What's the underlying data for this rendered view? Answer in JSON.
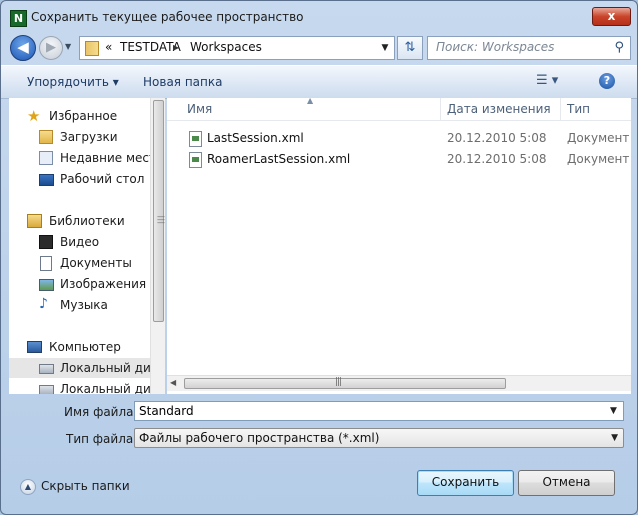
{
  "window": {
    "title": "Сохранить текущее рабочее пространство",
    "app_icon": "N",
    "close_glyph": "x"
  },
  "navigation": {
    "back_icon": "back-arrow-icon",
    "forward_icon": "forward-arrow-icon",
    "address": {
      "overflow_chevron": "«",
      "segments": [
        "TESTDATA",
        "Workspaces"
      ],
      "separator": "▸"
    },
    "search_placeholder": "Поиск: Workspaces"
  },
  "toolbar": {
    "organize_label": "Упорядочить ▾",
    "new_folder_label": "Новая папка"
  },
  "nav_pane": {
    "items": [
      {
        "label": "Избранное",
        "icon": "star-icon",
        "group": "favorites"
      },
      {
        "label": "Загрузки",
        "icon": "downloads-folder-icon"
      },
      {
        "label": "Недавние места",
        "icon": "recent-places-icon"
      },
      {
        "label": "Рабочий стол",
        "icon": "desktop-icon"
      },
      {
        "label": "Библиотеки",
        "icon": "libraries-icon",
        "group": "libraries"
      },
      {
        "label": "Видео",
        "icon": "video-icon"
      },
      {
        "label": "Документы",
        "icon": "documents-icon"
      },
      {
        "label": "Изображения",
        "icon": "pictures-icon"
      },
      {
        "label": "Музыка",
        "icon": "music-icon"
      },
      {
        "label": "Компьютер",
        "icon": "computer-icon",
        "group": "computer"
      },
      {
        "label": "Локальный диск",
        "icon": "local-disk-icon",
        "selected": true
      },
      {
        "label": "Локальный диск",
        "icon": "local-disk-icon"
      }
    ]
  },
  "file_list": {
    "columns": [
      "Имя",
      "Дата изменения",
      "Тип"
    ],
    "rows": [
      {
        "name": "LastSession.xml",
        "date": "20.12.2010 5:08",
        "type": "Документ X"
      },
      {
        "name": "RoamerLastSession.xml",
        "date": "20.12.2010 5:08",
        "type": "Документ X"
      }
    ]
  },
  "form": {
    "filename_label": "Имя файла:",
    "filename_value": "Standard",
    "filetype_label": "Тип файла:",
    "filetype_value": "Файлы рабочего пространства (*.xml)"
  },
  "footer": {
    "hide_folders_label": "Скрыть папки",
    "save_label": "Сохранить",
    "cancel_label": "Отмена"
  },
  "colors": {
    "chrome": "#b6cde8",
    "selection": "#e6e6e6",
    "accent": "#3c7fb1"
  }
}
